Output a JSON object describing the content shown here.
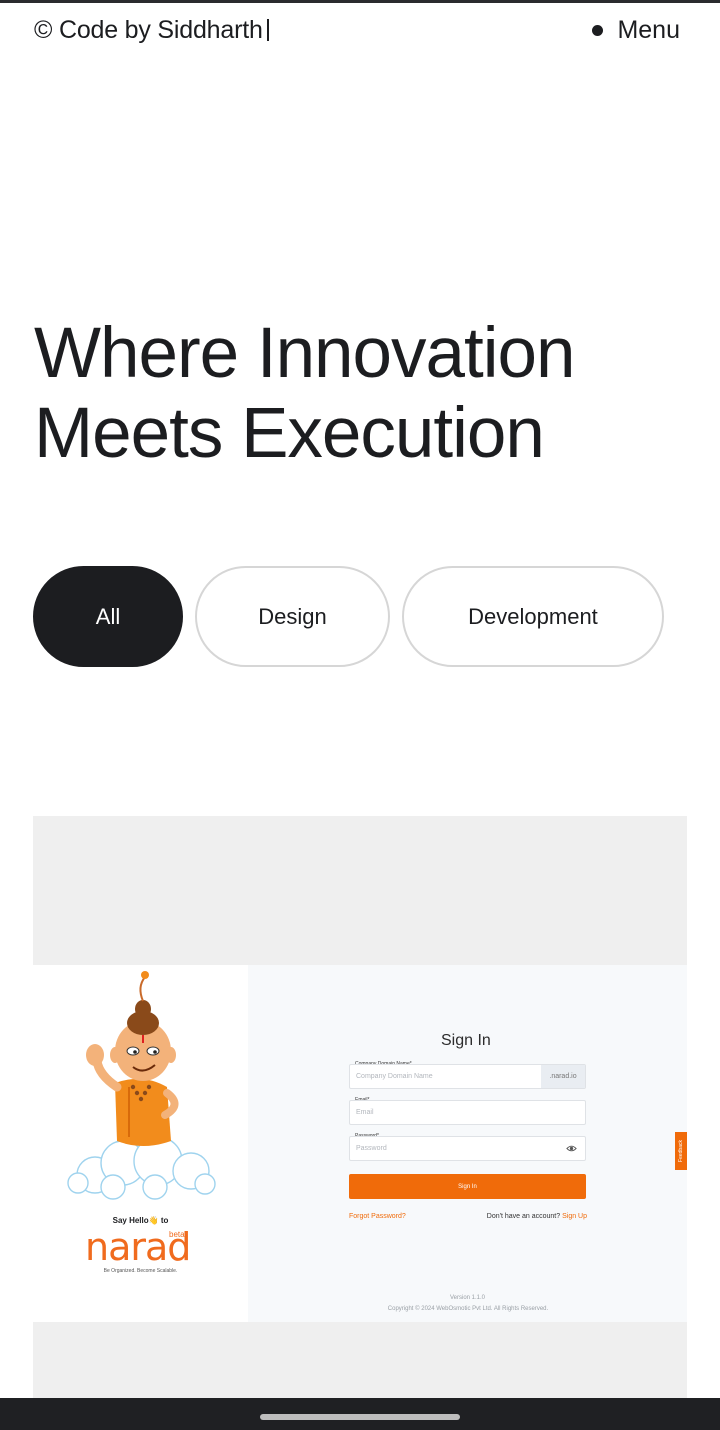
{
  "header": {
    "brand": "© Code by Siddharth",
    "menu_label": "Menu"
  },
  "hero": {
    "line1": "Where Innovation",
    "line2": "Meets Execution"
  },
  "filters": [
    {
      "label": "All",
      "active": true
    },
    {
      "label": "Design",
      "active": false
    },
    {
      "label": "Development",
      "active": false
    }
  ],
  "project": {
    "screenshot": {
      "say_hello": "Say Hello👋 to",
      "logo_text": "narad",
      "logo_badge": "beta",
      "tagline": "Be Organized. Become Scalable.",
      "signin_title": "Sign In",
      "company_label": "Company Domain Name*",
      "company_placeholder": "Company Domain Name",
      "company_suffix": ".narad.io",
      "email_label": "Email*",
      "email_placeholder": "Email",
      "password_label": "Password*",
      "password_placeholder": "Password",
      "signin_button": "Sign In",
      "forgot_password": "Forgot Password?",
      "no_account": "Don't have an account?",
      "signup": "Sign Up",
      "version": "Version 1.1.0",
      "copyright": "Copyright © 2024 WebOsmotic Pvt Ltd. All Rights Reserved.",
      "feedback": "Feedback"
    }
  },
  "colors": {
    "dark": "#1c1d20",
    "accent": "#f06b0a"
  }
}
